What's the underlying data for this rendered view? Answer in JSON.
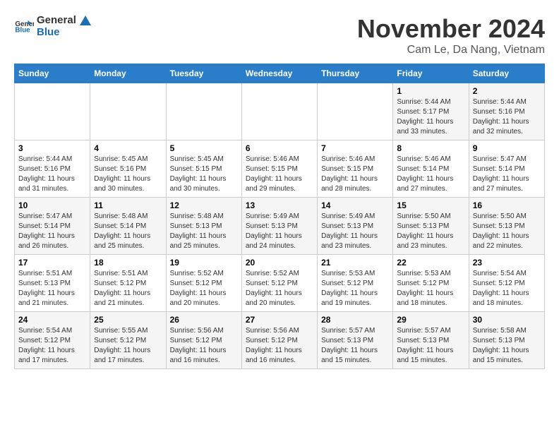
{
  "logo": {
    "general": "General",
    "blue": "Blue"
  },
  "title": "November 2024",
  "location": "Cam Le, Da Nang, Vietnam",
  "weekdays": [
    "Sunday",
    "Monday",
    "Tuesday",
    "Wednesday",
    "Thursday",
    "Friday",
    "Saturday"
  ],
  "weeks": [
    [
      {
        "day": "",
        "sunrise": "",
        "sunset": "",
        "daylight": ""
      },
      {
        "day": "",
        "sunrise": "",
        "sunset": "",
        "daylight": ""
      },
      {
        "day": "",
        "sunrise": "",
        "sunset": "",
        "daylight": ""
      },
      {
        "day": "",
        "sunrise": "",
        "sunset": "",
        "daylight": ""
      },
      {
        "day": "",
        "sunrise": "",
        "sunset": "",
        "daylight": ""
      },
      {
        "day": "1",
        "sunrise": "Sunrise: 5:44 AM",
        "sunset": "Sunset: 5:17 PM",
        "daylight": "Daylight: 11 hours and 33 minutes."
      },
      {
        "day": "2",
        "sunrise": "Sunrise: 5:44 AM",
        "sunset": "Sunset: 5:16 PM",
        "daylight": "Daylight: 11 hours and 32 minutes."
      }
    ],
    [
      {
        "day": "3",
        "sunrise": "Sunrise: 5:44 AM",
        "sunset": "Sunset: 5:16 PM",
        "daylight": "Daylight: 11 hours and 31 minutes."
      },
      {
        "day": "4",
        "sunrise": "Sunrise: 5:45 AM",
        "sunset": "Sunset: 5:16 PM",
        "daylight": "Daylight: 11 hours and 30 minutes."
      },
      {
        "day": "5",
        "sunrise": "Sunrise: 5:45 AM",
        "sunset": "Sunset: 5:15 PM",
        "daylight": "Daylight: 11 hours and 30 minutes."
      },
      {
        "day": "6",
        "sunrise": "Sunrise: 5:46 AM",
        "sunset": "Sunset: 5:15 PM",
        "daylight": "Daylight: 11 hours and 29 minutes."
      },
      {
        "day": "7",
        "sunrise": "Sunrise: 5:46 AM",
        "sunset": "Sunset: 5:15 PM",
        "daylight": "Daylight: 11 hours and 28 minutes."
      },
      {
        "day": "8",
        "sunrise": "Sunrise: 5:46 AM",
        "sunset": "Sunset: 5:14 PM",
        "daylight": "Daylight: 11 hours and 27 minutes."
      },
      {
        "day": "9",
        "sunrise": "Sunrise: 5:47 AM",
        "sunset": "Sunset: 5:14 PM",
        "daylight": "Daylight: 11 hours and 27 minutes."
      }
    ],
    [
      {
        "day": "10",
        "sunrise": "Sunrise: 5:47 AM",
        "sunset": "Sunset: 5:14 PM",
        "daylight": "Daylight: 11 hours and 26 minutes."
      },
      {
        "day": "11",
        "sunrise": "Sunrise: 5:48 AM",
        "sunset": "Sunset: 5:14 PM",
        "daylight": "Daylight: 11 hours and 25 minutes."
      },
      {
        "day": "12",
        "sunrise": "Sunrise: 5:48 AM",
        "sunset": "Sunset: 5:13 PM",
        "daylight": "Daylight: 11 hours and 25 minutes."
      },
      {
        "day": "13",
        "sunrise": "Sunrise: 5:49 AM",
        "sunset": "Sunset: 5:13 PM",
        "daylight": "Daylight: 11 hours and 24 minutes."
      },
      {
        "day": "14",
        "sunrise": "Sunrise: 5:49 AM",
        "sunset": "Sunset: 5:13 PM",
        "daylight": "Daylight: 11 hours and 23 minutes."
      },
      {
        "day": "15",
        "sunrise": "Sunrise: 5:50 AM",
        "sunset": "Sunset: 5:13 PM",
        "daylight": "Daylight: 11 hours and 23 minutes."
      },
      {
        "day": "16",
        "sunrise": "Sunrise: 5:50 AM",
        "sunset": "Sunset: 5:13 PM",
        "daylight": "Daylight: 11 hours and 22 minutes."
      }
    ],
    [
      {
        "day": "17",
        "sunrise": "Sunrise: 5:51 AM",
        "sunset": "Sunset: 5:13 PM",
        "daylight": "Daylight: 11 hours and 21 minutes."
      },
      {
        "day": "18",
        "sunrise": "Sunrise: 5:51 AM",
        "sunset": "Sunset: 5:12 PM",
        "daylight": "Daylight: 11 hours and 21 minutes."
      },
      {
        "day": "19",
        "sunrise": "Sunrise: 5:52 AM",
        "sunset": "Sunset: 5:12 PM",
        "daylight": "Daylight: 11 hours and 20 minutes."
      },
      {
        "day": "20",
        "sunrise": "Sunrise: 5:52 AM",
        "sunset": "Sunset: 5:12 PM",
        "daylight": "Daylight: 11 hours and 20 minutes."
      },
      {
        "day": "21",
        "sunrise": "Sunrise: 5:53 AM",
        "sunset": "Sunset: 5:12 PM",
        "daylight": "Daylight: 11 hours and 19 minutes."
      },
      {
        "day": "22",
        "sunrise": "Sunrise: 5:53 AM",
        "sunset": "Sunset: 5:12 PM",
        "daylight": "Daylight: 11 hours and 18 minutes."
      },
      {
        "day": "23",
        "sunrise": "Sunrise: 5:54 AM",
        "sunset": "Sunset: 5:12 PM",
        "daylight": "Daylight: 11 hours and 18 minutes."
      }
    ],
    [
      {
        "day": "24",
        "sunrise": "Sunrise: 5:54 AM",
        "sunset": "Sunset: 5:12 PM",
        "daylight": "Daylight: 11 hours and 17 minutes."
      },
      {
        "day": "25",
        "sunrise": "Sunrise: 5:55 AM",
        "sunset": "Sunset: 5:12 PM",
        "daylight": "Daylight: 11 hours and 17 minutes."
      },
      {
        "day": "26",
        "sunrise": "Sunrise: 5:56 AM",
        "sunset": "Sunset: 5:12 PM",
        "daylight": "Daylight: 11 hours and 16 minutes."
      },
      {
        "day": "27",
        "sunrise": "Sunrise: 5:56 AM",
        "sunset": "Sunset: 5:12 PM",
        "daylight": "Daylight: 11 hours and 16 minutes."
      },
      {
        "day": "28",
        "sunrise": "Sunrise: 5:57 AM",
        "sunset": "Sunset: 5:13 PM",
        "daylight": "Daylight: 11 hours and 15 minutes."
      },
      {
        "day": "29",
        "sunrise": "Sunrise: 5:57 AM",
        "sunset": "Sunset: 5:13 PM",
        "daylight": "Daylight: 11 hours and 15 minutes."
      },
      {
        "day": "30",
        "sunrise": "Sunrise: 5:58 AM",
        "sunset": "Sunset: 5:13 PM",
        "daylight": "Daylight: 11 hours and 15 minutes."
      }
    ]
  ]
}
